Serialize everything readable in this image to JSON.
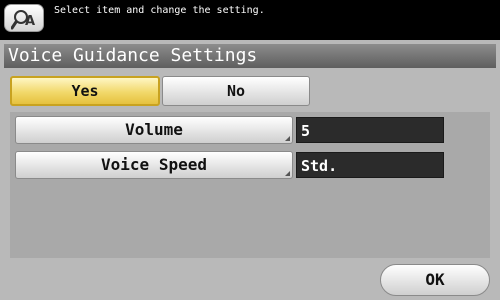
{
  "message_bar": {
    "help_icon": "help-magnifier-icon",
    "message": "Select item and change the setting."
  },
  "panel": {
    "title": "Voice Guidance Settings",
    "toggle": {
      "options": [
        "Yes",
        "No"
      ],
      "selected": "Yes"
    },
    "settings": [
      {
        "label": "Volume",
        "value": "5"
      },
      {
        "label": "Voice Speed",
        "value": "Std."
      }
    ],
    "ok_label": "OK"
  },
  "colors": {
    "selected_fill": "#f1d86a",
    "title_bar": "#6f6f6f",
    "panel_bg": "#b9b9b9",
    "value_box": "#2b2b2b"
  }
}
